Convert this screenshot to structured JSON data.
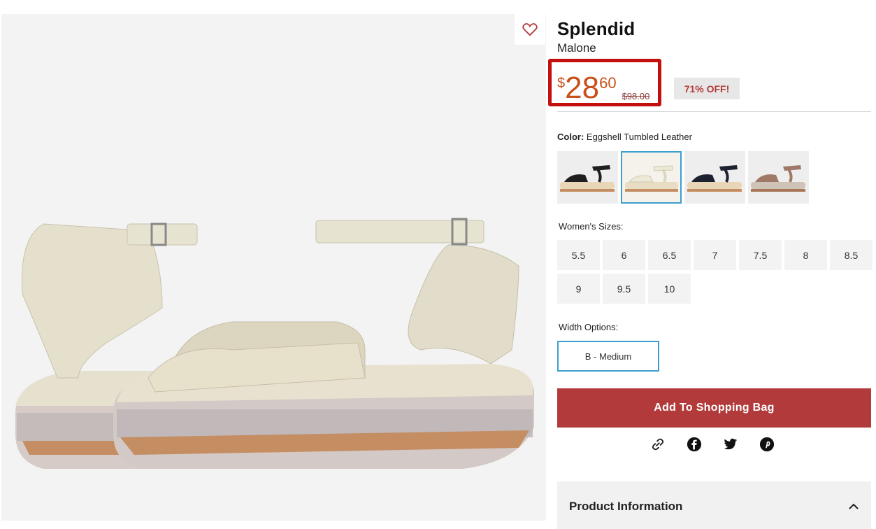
{
  "product": {
    "brand": "Splendid",
    "model": "Malone",
    "price": {
      "symbol": "$",
      "dollars": "28",
      "cents": "60",
      "original": "$98.00"
    },
    "discount": "71% OFF!"
  },
  "color": {
    "label": "Color:",
    "value": "Eggshell Tumbled Leather",
    "swatches": [
      {
        "name": "black-leather",
        "strap_color": "#1f1f1f",
        "sole_color": "#e8d6b6"
      },
      {
        "name": "eggshell-tumbled-leather",
        "strap_color": "#ece9d6",
        "sole_color": "#e8dcc2",
        "selected": true
      },
      {
        "name": "navy-leather",
        "strap_color": "#1d2230",
        "sole_color": "#e8d6b6"
      },
      {
        "name": "rose-gold",
        "strap_color": "#a07868",
        "sole_color": "#cfc3b8"
      }
    ]
  },
  "sizes": {
    "label": "Women's Sizes:",
    "options": [
      "5.5",
      "6",
      "6.5",
      "7",
      "7.5",
      "8",
      "8.5",
      "9",
      "9.5",
      "10"
    ]
  },
  "width": {
    "label": "Width Options:",
    "options": [
      "B - Medium"
    ]
  },
  "actions": {
    "add_to_bag": "Add To Shopping Bag"
  },
  "share_icons": [
    "link-icon",
    "facebook-icon",
    "twitter-icon",
    "pinterest-icon"
  ],
  "accordion": {
    "product_info": "Product Information"
  },
  "colors": {
    "accent": "#b23a3a",
    "price": "#c8501a",
    "highlight_border": "#c40f0f",
    "selected_border": "#3c9fd0"
  }
}
